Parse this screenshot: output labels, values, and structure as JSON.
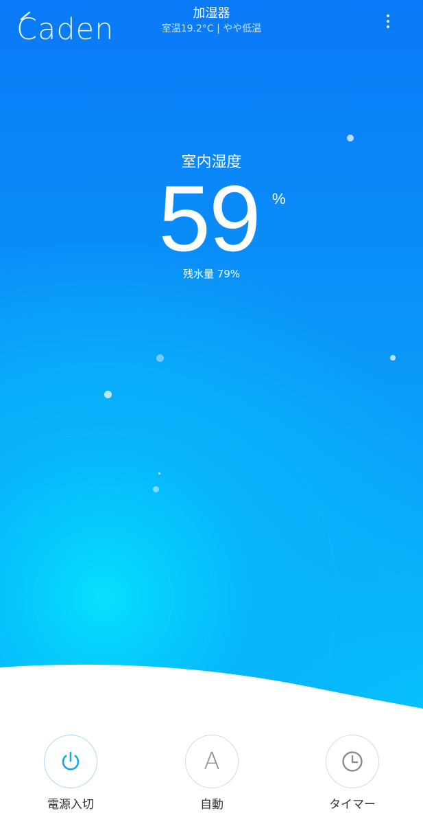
{
  "header": {
    "brand_logo_text": "Caden",
    "title": "加湿器",
    "subtitle": "室温19.2°C | やや低温",
    "menu_icon": "more-vertical-icon"
  },
  "main": {
    "humidity_label": "室内湿度",
    "humidity_value": "59",
    "humidity_unit": "%",
    "water_level_text": "残水量 79%"
  },
  "controls": [
    {
      "label": "電源入切",
      "icon": "power-icon",
      "active": true
    },
    {
      "label": "自動",
      "icon": "auto-icon",
      "glyph": "A",
      "active": false
    },
    {
      "label": "タイマー",
      "icon": "clock-icon",
      "active": false
    }
  ],
  "colors": {
    "hero_top": "#0a79f7",
    "hero_bottom": "#07c2fc",
    "accent": "#14a7ec",
    "icon_gray": "#8a8a8a",
    "label_text": "#333333"
  }
}
